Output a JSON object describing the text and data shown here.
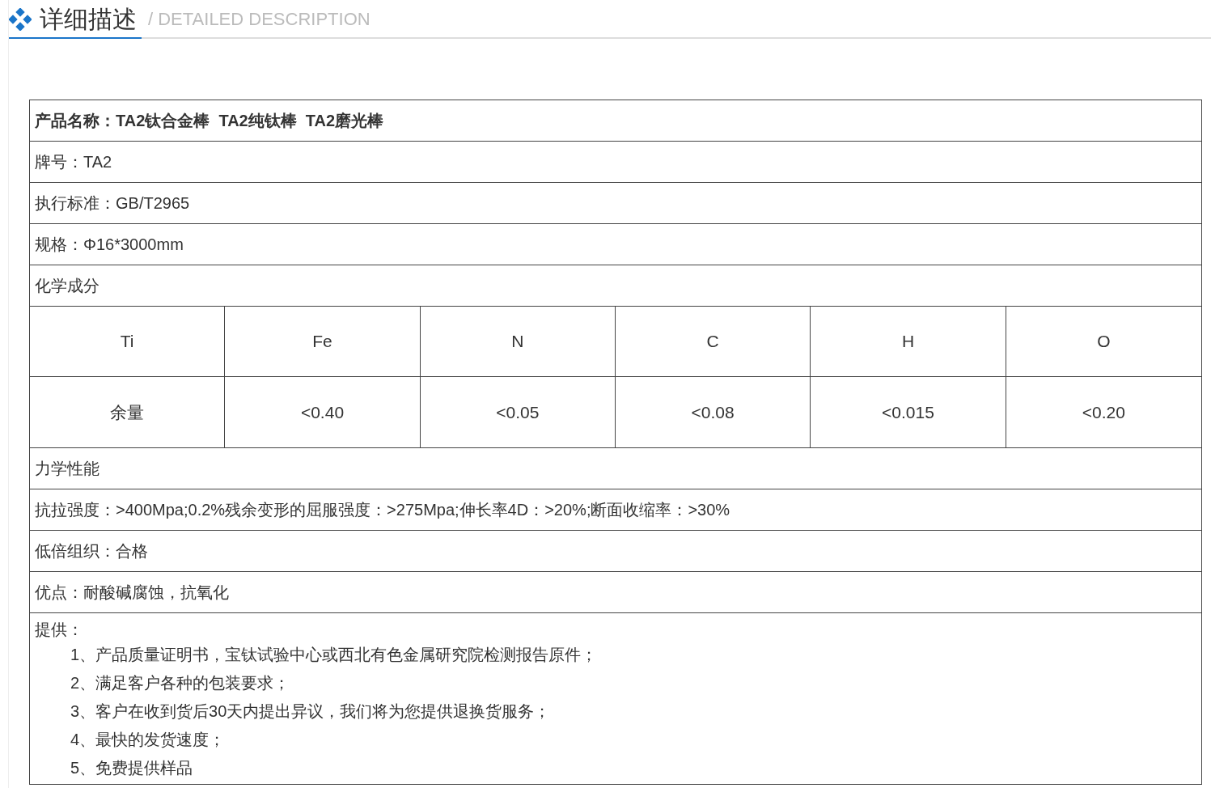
{
  "header": {
    "title": "详细描述",
    "subtitle": "/ DETAILED DESCRIPTION"
  },
  "table": {
    "rows": [
      {
        "kind": "line",
        "bold": true,
        "text": "产品名称：TA2钛合金棒  TA2纯钛棒  TA2磨光棒"
      },
      {
        "kind": "line",
        "bold": false,
        "text": "牌号：TA2"
      },
      {
        "kind": "line",
        "bold": false,
        "text": "执行标准：GB/T2965"
      },
      {
        "kind": "line",
        "bold": false,
        "text": "规格：Φ16*3000mm"
      },
      {
        "kind": "line",
        "bold": false,
        "text": "化学成分"
      },
      {
        "kind": "grid",
        "rows": [
          [
            "Ti",
            "Fe",
            "N",
            "C",
            "H",
            "O"
          ],
          [
            "余量",
            "<0.40",
            "<0.05",
            "<0.08",
            "<0.015",
            "<0.20"
          ]
        ]
      },
      {
        "kind": "line",
        "bold": false,
        "text": "力学性能"
      },
      {
        "kind": "line",
        "bold": false,
        "text": "抗拉强度：>400Mpa;0.2%残余变形的屈服强度：>275Mpa;伸长率4D：>20%;断面收缩率：>30%"
      },
      {
        "kind": "line",
        "bold": false,
        "text": "低倍组织：合格"
      },
      {
        "kind": "line",
        "bold": false,
        "text": "优点：耐酸碱腐蚀，抗氧化"
      },
      {
        "kind": "list",
        "label": "提供：",
        "items": [
          "1、产品质量证明书，宝钛试验中心或西北有色金属研究院检测报告原件；",
          "2、满足客户各种的包装要求；",
          "3、客户在收到货后30天内提出异议，我们将为您提供退换货服务；",
          "4、最快的发货速度；",
          "5、免费提供样品"
        ]
      }
    ]
  }
}
